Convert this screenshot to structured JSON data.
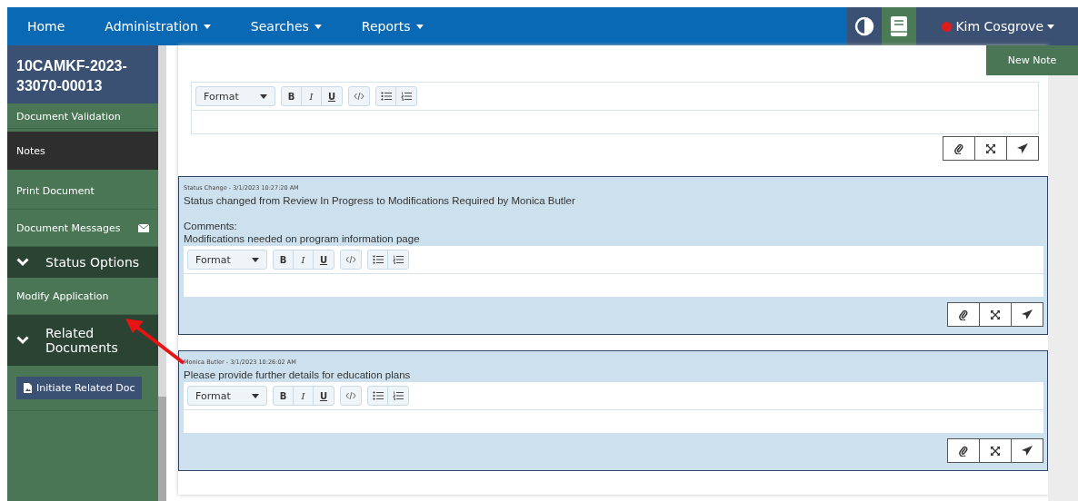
{
  "nav": {
    "items": [
      {
        "label": "Home",
        "dropdown": false
      },
      {
        "label": "Administration",
        "dropdown": true
      },
      {
        "label": "Searches",
        "dropdown": true
      },
      {
        "label": "Reports",
        "dropdown": true
      }
    ],
    "user": {
      "name": "Kim Cosgrove",
      "dropdown": true
    }
  },
  "new_note_button": "New Note",
  "sidebar": {
    "title": "10CAMKF-2023-33070-00013",
    "items": [
      {
        "kind": "link",
        "label": "Document Validation",
        "selected": false
      },
      {
        "kind": "link",
        "label": "Notes",
        "selected": true
      },
      {
        "kind": "link",
        "label": "Print Document",
        "selected": false
      },
      {
        "kind": "link",
        "label": "Document Messages",
        "selected": false,
        "mail_icon": true
      },
      {
        "kind": "section",
        "label": "Status Options",
        "expanded": true
      },
      {
        "kind": "link",
        "label": "Modify Application",
        "selected": false
      },
      {
        "kind": "section",
        "label": "Related Documents",
        "expanded": true
      },
      {
        "kind": "button",
        "label": "Initiate Related Doc"
      }
    ]
  },
  "new_note_editor": {
    "toolbar": {
      "format": "Format",
      "buttons": [
        "B",
        "I",
        "U"
      ]
    }
  },
  "notes": [
    {
      "header": "Status Change - 3/1/2023 10:27:20 AM",
      "message": "Status changed from Review In Progress to Modifications Required by Monica Butler",
      "comment_label": "Comments:",
      "comment": "Modifications needed on program information page",
      "toolbar": {
        "format": "Format",
        "buttons": [
          "B",
          "I",
          "U"
        ]
      }
    },
    {
      "header": "Monica Butler - 3/1/2023 10:26:02 AM",
      "message": "Please provide further details for education plans",
      "toolbar": {
        "format": "Format",
        "buttons": [
          "B",
          "I",
          "U"
        ]
      }
    }
  ]
}
